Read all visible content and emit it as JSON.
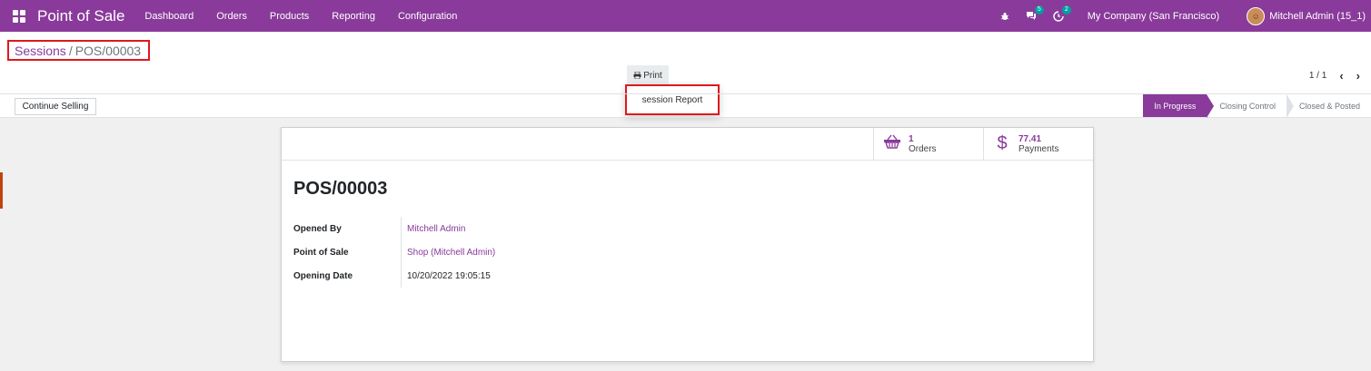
{
  "navbar": {
    "app_title": "Point of Sale",
    "menu": [
      "Dashboard",
      "Orders",
      "Products",
      "Reporting",
      "Configuration"
    ],
    "chat_badge": "5",
    "activity_badge": "2",
    "company": "My Company (San Francisco)",
    "user": "Mitchell Admin (15_1)"
  },
  "breadcrumb": {
    "parent": "Sessions",
    "separator": "/",
    "current": "POS/00003"
  },
  "toolbar": {
    "print_label": "Print",
    "print_icon": "printer-icon",
    "dropdown_item": "session Report",
    "pager": "1 / 1"
  },
  "actions": {
    "continue_selling": "Continue Selling"
  },
  "statusbar": {
    "steps": [
      "In Progress",
      "Closing Control",
      "Closed & Posted"
    ],
    "active": "In Progress",
    "active_color": "#893a9a"
  },
  "sheet": {
    "stats": [
      {
        "icon": "basket-icon",
        "value": "1",
        "label": "Orders"
      },
      {
        "icon": "dollar-icon",
        "value": "77.41",
        "label": "Payments"
      }
    ],
    "title": "POS/00003",
    "fields": [
      {
        "label": "Opened By",
        "value": "Mitchell Admin"
      },
      {
        "label": "Point of Sale",
        "value": "Shop (Mitchell Admin)"
      },
      {
        "label": "Opening Date",
        "value": "10/20/2022 19:05:15"
      }
    ]
  }
}
